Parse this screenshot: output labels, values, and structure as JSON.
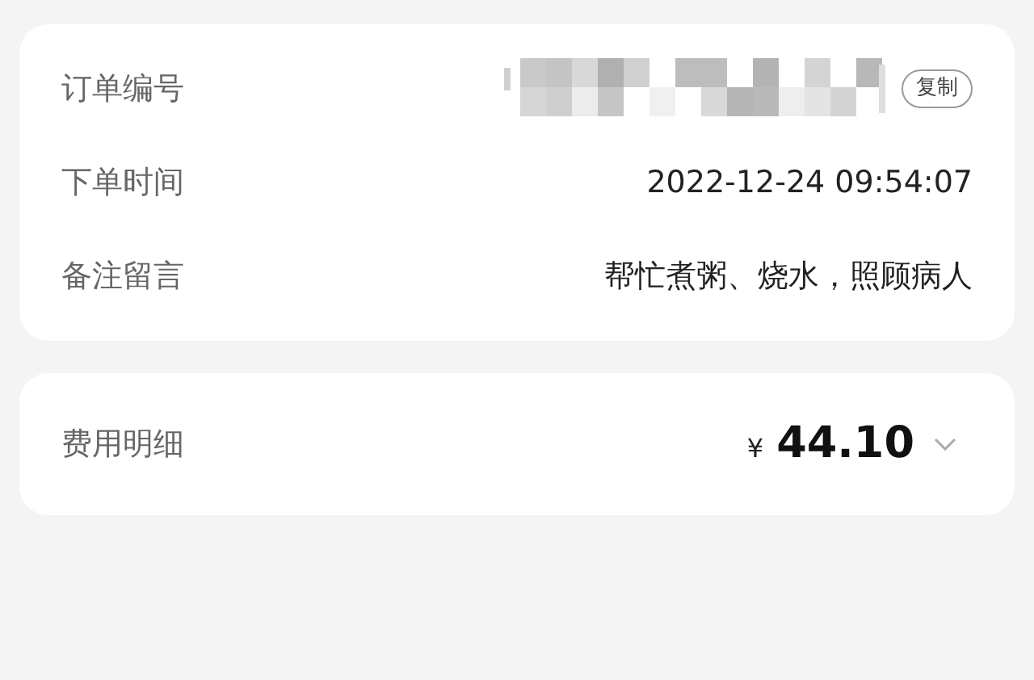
{
  "order_info": {
    "rows": [
      {
        "kind": "redacted",
        "label": "订单编号",
        "button": "复制"
      },
      {
        "kind": "text",
        "label": "下单时间",
        "value": "2022-12-24 09:54:07"
      },
      {
        "kind": "text",
        "label": "备注留言",
        "value": "帮忙煮粥、烧水，照顾病人"
      }
    ]
  },
  "cost": {
    "label": "费用明细",
    "currency": "¥",
    "amount": "44.10"
  }
}
